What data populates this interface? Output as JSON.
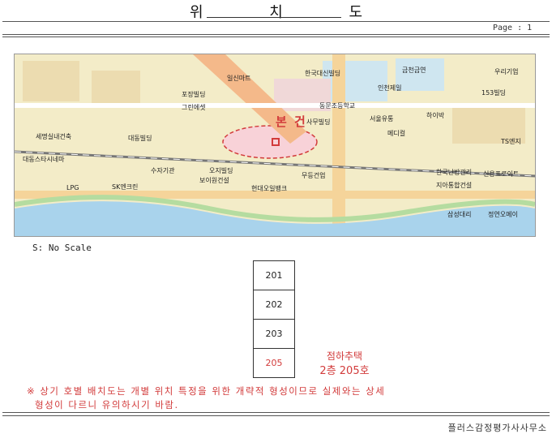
{
  "header": {
    "title": "위 치 도",
    "page_label": "Page : 1"
  },
  "map": {
    "labels": [
      "일신마트",
      "포장빌딩",
      "그린에셋",
      "대동빌딩",
      "한국대신빌딩",
      "금천금연",
      "동문조등학교",
      "인천제일",
      "사무빌딩",
      "서울유통",
      "메디컬",
      "하이박",
      "TS엔지",
      "수자기관",
      "오지빌딩",
      "보이원건설",
      "현대오일뱅크",
      "무등건업",
      "한국난방관리",
      "신용프로이트",
      "지아통합건설",
      "우리기업",
      "153빌딩",
      "삼성대리",
      "정연오메이",
      "세명실내건축",
      "대동스타시네마",
      "LPG",
      "SK엔크린"
    ],
    "target_label": "본 건"
  },
  "scale_label": "S: No Scale",
  "units": [
    "201",
    "202",
    "203",
    "205"
  ],
  "note": {
    "line1": "점하추택",
    "line2": "2층 205호"
  },
  "warning": {
    "line1": "※ 상기 호별 배치도는 개별 위치 특정을 위한 개략적 형성이므로 실제와는 상세",
    "line2": "형성이 다르니 유의하시기 바람."
  },
  "footer": "플러스감정평가사사무소"
}
